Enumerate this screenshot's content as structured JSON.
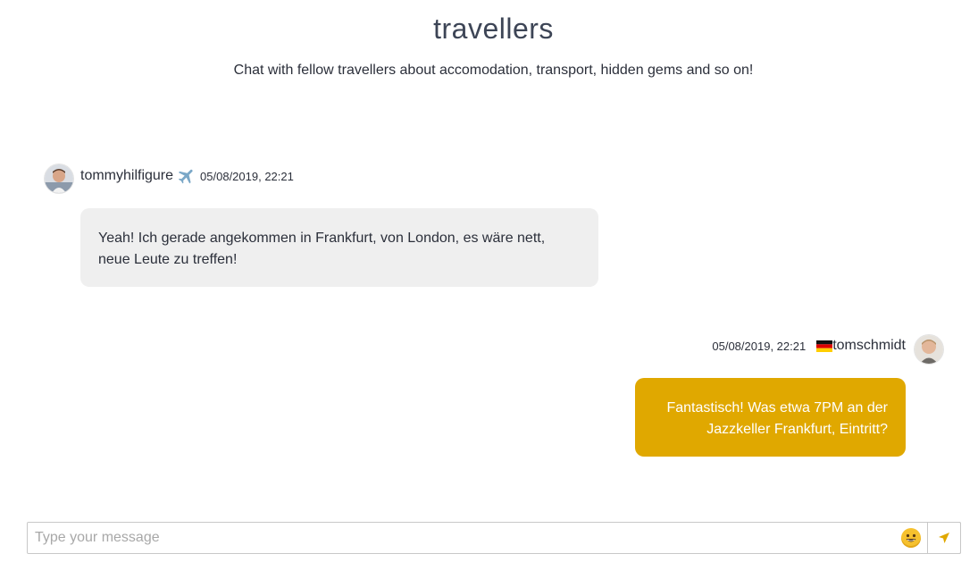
{
  "channel": {
    "title": "travellers",
    "description": "Chat with fellow travellers about accomodation, transport, hidden gems and so on!"
  },
  "messages": [
    {
      "username": "tommyhilfigure",
      "badge_icon": "airplane-icon",
      "timestamp": "05/08/2019, 22:21",
      "text_lines": [
        "Yeah! Ich gerade angekommen in Frankfurt, von London, es wäre nett,",
        "neue Leute zu treffen!"
      ],
      "direction": "incoming",
      "bubble_color": "#efefef"
    },
    {
      "username": "tomschmidt",
      "badge_icon": "germany-flag-icon",
      "timestamp": "05/08/2019, 22:21",
      "text_lines": [
        "Fantastisch! Was etwa 7PM an der",
        "Jazzkeller Frankfurt, Eintritt?"
      ],
      "direction": "outgoing",
      "bubble_color": "#e0a800"
    }
  ],
  "composer": {
    "placeholder": "Type your message",
    "emoji_icon": "emoji-smile-icon",
    "send_icon": "send-arrow-icon",
    "accent_color": "#e0a800"
  }
}
